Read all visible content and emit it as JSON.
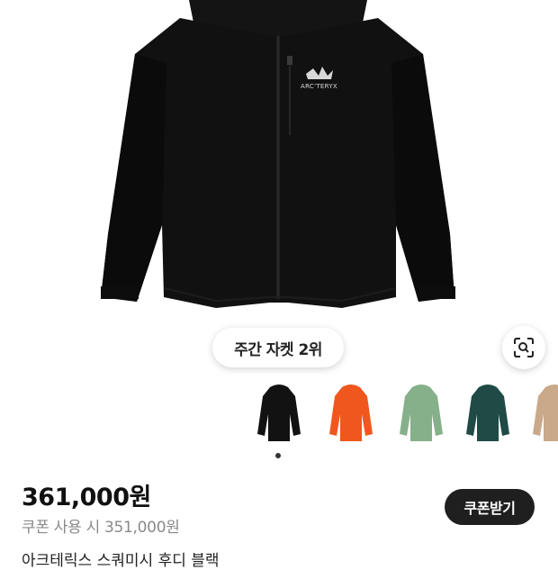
{
  "product": {
    "brand_logo_text": "ARC'TERYX",
    "rank_badge": "주간 자켓 2위",
    "price": "361,000원",
    "coupon_price": "쿠폰 사용 시 351,000원",
    "next_title": "아크테릭스 스쿼미시 후디 블랙"
  },
  "actions": {
    "coupon_button": "쿠폰받기",
    "lens_icon": "camera-search-icon"
  },
  "colors": {
    "jacket_black": "#111111",
    "button_dark": "#1f1f1f",
    "secondary_text": "#8a8a8a"
  },
  "color_options": [
    {
      "name": "black",
      "color": "#121212"
    },
    {
      "name": "orange",
      "color": "#f0571e"
    },
    {
      "name": "sage-green",
      "color": "#86b08a"
    },
    {
      "name": "dark-teal",
      "color": "#1f4a45"
    },
    {
      "name": "tan",
      "color": "#c9a98a"
    }
  ],
  "selected_color_index": 0
}
